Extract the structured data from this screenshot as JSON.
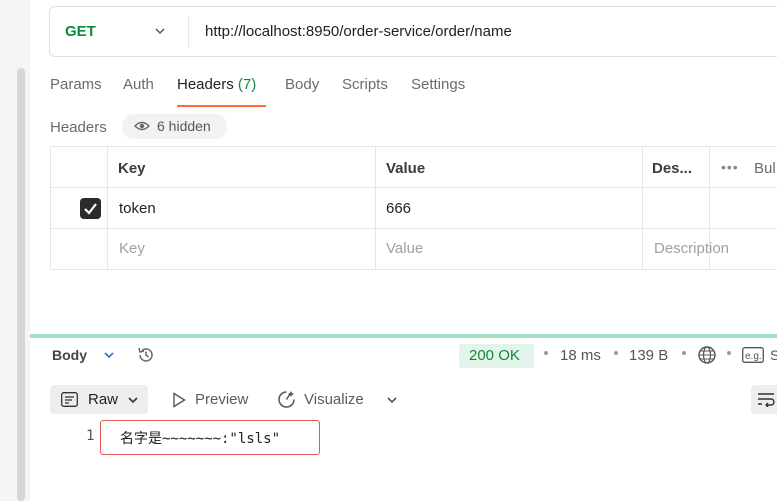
{
  "request": {
    "method": "GET",
    "url": "http://localhost:8950/order-service/order/name"
  },
  "request_tabs": {
    "params": "Params",
    "auth": "Auth",
    "headers": "Headers",
    "headers_count": "(7)",
    "body": "Body",
    "scripts": "Scripts",
    "settings": "Settings"
  },
  "headers_section": {
    "label": "Headers",
    "hidden": "6 hidden"
  },
  "headers_table": {
    "columns": [
      "Key",
      "Value",
      "Des...",
      "Bul"
    ],
    "rows": [
      {
        "checked": true,
        "key": "token",
        "value": "666",
        "description": ""
      }
    ],
    "placeholders": {
      "key": "Key",
      "value": "Value",
      "description": "Description"
    }
  },
  "response": {
    "body_label": "Body",
    "status": "200 OK",
    "time": "18 ms",
    "size": "139 B",
    "truncated_label": "S",
    "eg_label": "e.g.",
    "view_tabs": {
      "raw": "Raw",
      "preview": "Preview",
      "visualize": "Visualize"
    },
    "line_number": "1",
    "content": "名字是~~~~~~~:\"lsls\""
  },
  "colors": {
    "method_green": "#0f8a3c",
    "active_tab_underline": "#ff6c37",
    "status_bg": "#e3f4ea",
    "divider_green": "#a3e1c3",
    "highlight_red": "#e05a4f"
  },
  "icons": [
    "chevron-down-icon",
    "eye-icon",
    "checkbox-checked-icon",
    "more-icon",
    "history-icon",
    "globe-icon",
    "example-icon",
    "raw-text-icon",
    "play-icon",
    "visualize-icon",
    "wrap-lines-icon"
  ]
}
